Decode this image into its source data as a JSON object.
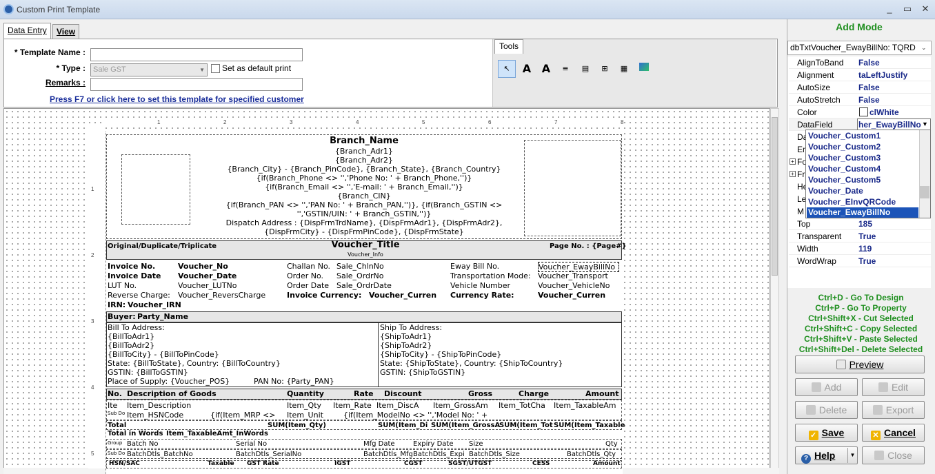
{
  "window": {
    "title": "Custom Print Template",
    "min": "_",
    "max": "▭",
    "close": "✕"
  },
  "tabs": {
    "data_entry": "Data Entry",
    "view": "View"
  },
  "form": {
    "template_name_label": "* Template Name :",
    "template_name_value": "",
    "type_label": "* Type :",
    "type_value": "Sale GST",
    "default_checkbox_label": "Set as default print",
    "remarks_label": "Remarks :",
    "remarks_value": "",
    "customer_link": "Press F7 or click here to set this template for specified customer"
  },
  "tools": {
    "title": "Tools",
    "items": [
      "pointer",
      "label",
      "label-multi",
      "memo",
      "rich-text",
      "system",
      "calc",
      "image",
      "shape"
    ]
  },
  "ruler": {
    "top": [
      "1",
      "2",
      "3",
      "4",
      "5",
      "6",
      "7",
      "8"
    ],
    "left": [
      "1",
      "2",
      "3",
      "4",
      "5"
    ]
  },
  "report": {
    "branch_name": "Branch_Name",
    "header_lines": [
      "{Branch_Adr1}",
      "{Branch_Adr2}",
      "{Branch_City} - {Branch_PinCode}, {Branch_State}, {Branch_Country}",
      "{if(Branch_Phone <> '','Phone No: ' + Branch_Phone,'')}",
      "{if(Branch_Email <> '','E-mail: ' + Branch_Email,'')}",
      "{Branch_CIN}",
      "{if(Branch_PAN <> '','PAN No: ' + Branch_PAN,'')}, {if(Branch_GSTIN <>",
      "'','GSTIN/UIN: ' + Branch_GSTIN,'')}",
      "Dispatch Address : {DispFrmTrdName},  {DispFrmAdr1},  {DispFrmAdr2},",
      "{DispFrmCity} - {DispFrmPinCode}, {DispFrmState}"
    ],
    "copy_label": "Original/Duplicate/Triplicate",
    "voucher_title": "Voucher_Title",
    "page_no": "Page No. : {Page#}",
    "voucher_info": "Voucher_Info",
    "invoice_no": "Invoice No.",
    "voucher_no": "Voucher_No",
    "invoice_date": "Invoice Date",
    "voucher_date": "Voucher_Date",
    "lut_no": "LUT No.",
    "voucher_lutno": "Voucher_LUTNo",
    "reverse_charge": "Reverse Charge:",
    "voucher_reverscharge": "Voucher_ReversCharge",
    "irn": "IRN:",
    "voucher_irn": "Voucher_IRN",
    "challan_no": "Challan No.",
    "sale_chlnno": "Sale_ChlnNo",
    "order_no": "Order No.",
    "sale_ordrno": "Sale_OrdrNo",
    "order_date": "Order Date",
    "sale_ordrdate": "Sale_OrdrDate",
    "invoice_currency": "Invoice Currency:",
    "voucher_curren": "Voucher_Curren",
    "eway_bill_no": "Eway Bill No.",
    "voucher_ewaybillno": "Voucher_EwayBillNo",
    "transportation_mode": "Transportation Mode:",
    "voucher_transport": "Voucher_Transport",
    "vehicle_number": "Vehicle Number",
    "voucher_vehicleno": "Voucher_VehicleNo",
    "currency_rate": "Currency Rate:",
    "voucher_curren2": "Voucher_Curren",
    "buyer": "Buyer:",
    "party_name": "Party_Name",
    "bill_lines": [
      "Bill To Address:",
      "{BillToAdr1}",
      "{BillToAdr2}",
      "{BillToCity} - {BillToPinCode}",
      "State: {BillToState}, Country: {BillToCountry}",
      "GSTIN: {BillToGSTIN}"
    ],
    "place_of_supply": "Place of Supply: {Voucher_POS}",
    "pan_no": "PAN No: {Party_PAN}",
    "ship_lines": [
      "Ship To Address:",
      "{ShipToAdr1}",
      "{ShipToAdr2}",
      "{ShipToCity} - {ShipToPinCode}",
      "State: {ShipToState}, Country: {ShipToCountry}",
      "GSTIN: {ShipToGSTIN}"
    ],
    "cols": {
      "no": "No.",
      "desc": "Description of Goods",
      "qty": "Quantity",
      "rate": "Rate",
      "discount": "Discount",
      "gross": "Gross",
      "charge": "Charge",
      "amount": "Amount"
    },
    "item_row1": {
      "ite": "Ite",
      "desc": "Item_Description",
      "qty": "Item_Qty",
      "rate": "Item_Rate",
      "disc": "Item_DiscA",
      "gross": "Item_GrossAm",
      "charge": "Item_TotCha",
      "amount": "Item_TaxableAm"
    },
    "item_row2": {
      "sub": "Sub Do",
      "hsn": "Item_HSNCode",
      "mrp": "{if(Item_MRP <>",
      "unit": "Item_Unit",
      "model": "{if(Item_ModelNo <> '','Model No: ' +"
    },
    "total": "Total",
    "sum_qty": "SUM(Item_Qty)",
    "sum_d": "SUM(Item_Di",
    "sum_gross": "SUM(Item_GrossA",
    "sum_tot": "SUM(Item_Tot",
    "sum_taxable": "SUM(Item_Taxable",
    "total_words": "Total in Words",
    "taxable_words": "Item_TaxableAmt_InWords",
    "batch_header": {
      "group": "Group",
      "batch": "Batch No",
      "serial": "Serial No",
      "mfg": "Mfg Date",
      "expiry": "Expiry Date",
      "size": "Size",
      "qty": "Qty"
    },
    "batch_row": {
      "sub": "Sub Do",
      "batch": "BatchDtls_BatchNo",
      "serial": "BatchDtls_SerialNo",
      "mfg": "BatchDtls_Mfg",
      "expiry": "BatchDtls_Expi",
      "size": "BatchDtls_Size",
      "qty": "BatchDtls_Qty"
    },
    "tax_header": {
      "hsn": "HSN/SAC",
      "taxable": "Taxable",
      "gst_rate": "GST Rate",
      "igst": "IGST",
      "cgst": "CGST",
      "sgst": "SGST/UTGST",
      "cess": "CESS",
      "amount": "Amount"
    }
  },
  "right_panel": {
    "mode": "Add Mode",
    "component": "dbTxtVoucher_EwayBillNo: TQRD",
    "properties": [
      {
        "name": "AlignToBand",
        "value": "False"
      },
      {
        "name": "Alignment",
        "value": "taLeftJustify"
      },
      {
        "name": "AutoSize",
        "value": "False"
      },
      {
        "name": "AutoStretch",
        "value": "False"
      },
      {
        "name": "Color",
        "value": "clWhite"
      },
      {
        "name": "DataField",
        "value": "her_EwayBillNo"
      },
      {
        "name": "Da",
        "value": ""
      },
      {
        "name": "En",
        "value": ""
      },
      {
        "name": "Fo",
        "value": ""
      },
      {
        "name": "Fr",
        "value": ""
      },
      {
        "name": "He",
        "value": ""
      },
      {
        "name": "Le",
        "value": ""
      },
      {
        "name": "M",
        "value": ""
      },
      {
        "name": "Top",
        "value": "185"
      },
      {
        "name": "Transparent",
        "value": "True"
      },
      {
        "name": "Width",
        "value": "119"
      },
      {
        "name": "WordWrap",
        "value": "True"
      }
    ],
    "datafield_options": [
      "Voucher_Custom1",
      "Voucher_Custom2",
      "Voucher_Custom3",
      "Voucher_Custom4",
      "Voucher_Custom5",
      "Voucher_Date",
      "Voucher_EInvQRCode",
      "Voucher_EwayBillNo"
    ],
    "selected_option": "Voucher_EwayBillNo",
    "shortcuts": [
      "Ctrl+D - Go To Design",
      "Ctrl+P - Go To Property",
      "Ctrl+Shift+X - Cut Selected",
      "Ctrl+Shift+C - Copy Selected",
      "Ctrl+Shift+V - Paste Selected",
      "Ctrl+Shift+Del - Delete Selected"
    ],
    "buttons": {
      "preview": "Preview",
      "add": "Add",
      "edit": "Edit",
      "delete": "Delete",
      "export": "Export",
      "save": "Save",
      "cancel": "Cancel",
      "help": "Help",
      "close": "Close"
    }
  },
  "colors": {
    "accent_green": "#1f8f1f",
    "link_blue": "#1b2f9b",
    "value_blue": "#1a2a8a",
    "selection": "#1c54b8"
  }
}
